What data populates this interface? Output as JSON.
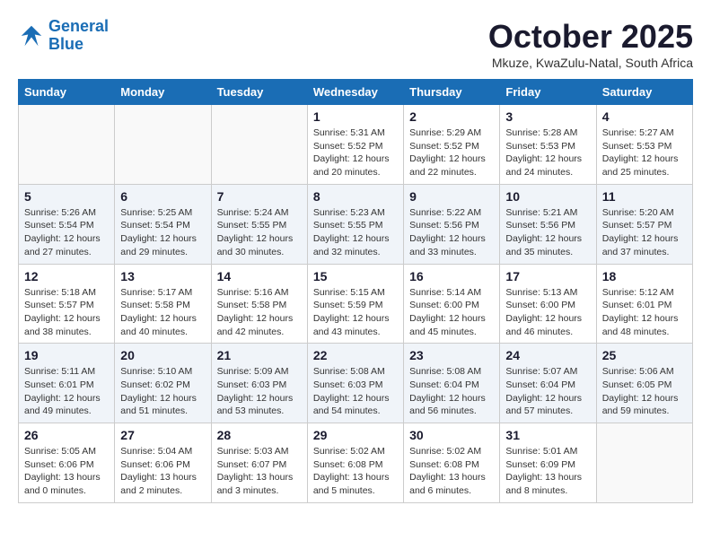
{
  "header": {
    "logo_line1": "General",
    "logo_line2": "Blue",
    "month_title": "October 2025",
    "location": "Mkuze, KwaZulu-Natal, South Africa"
  },
  "days_of_week": [
    "Sunday",
    "Monday",
    "Tuesday",
    "Wednesday",
    "Thursday",
    "Friday",
    "Saturday"
  ],
  "weeks": [
    [
      {
        "day": "",
        "info": ""
      },
      {
        "day": "",
        "info": ""
      },
      {
        "day": "",
        "info": ""
      },
      {
        "day": "1",
        "info": "Sunrise: 5:31 AM\nSunset: 5:52 PM\nDaylight: 12 hours\nand 20 minutes."
      },
      {
        "day": "2",
        "info": "Sunrise: 5:29 AM\nSunset: 5:52 PM\nDaylight: 12 hours\nand 22 minutes."
      },
      {
        "day": "3",
        "info": "Sunrise: 5:28 AM\nSunset: 5:53 PM\nDaylight: 12 hours\nand 24 minutes."
      },
      {
        "day": "4",
        "info": "Sunrise: 5:27 AM\nSunset: 5:53 PM\nDaylight: 12 hours\nand 25 minutes."
      }
    ],
    [
      {
        "day": "5",
        "info": "Sunrise: 5:26 AM\nSunset: 5:54 PM\nDaylight: 12 hours\nand 27 minutes."
      },
      {
        "day": "6",
        "info": "Sunrise: 5:25 AM\nSunset: 5:54 PM\nDaylight: 12 hours\nand 29 minutes."
      },
      {
        "day": "7",
        "info": "Sunrise: 5:24 AM\nSunset: 5:55 PM\nDaylight: 12 hours\nand 30 minutes."
      },
      {
        "day": "8",
        "info": "Sunrise: 5:23 AM\nSunset: 5:55 PM\nDaylight: 12 hours\nand 32 minutes."
      },
      {
        "day": "9",
        "info": "Sunrise: 5:22 AM\nSunset: 5:56 PM\nDaylight: 12 hours\nand 33 minutes."
      },
      {
        "day": "10",
        "info": "Sunrise: 5:21 AM\nSunset: 5:56 PM\nDaylight: 12 hours\nand 35 minutes."
      },
      {
        "day": "11",
        "info": "Sunrise: 5:20 AM\nSunset: 5:57 PM\nDaylight: 12 hours\nand 37 minutes."
      }
    ],
    [
      {
        "day": "12",
        "info": "Sunrise: 5:18 AM\nSunset: 5:57 PM\nDaylight: 12 hours\nand 38 minutes."
      },
      {
        "day": "13",
        "info": "Sunrise: 5:17 AM\nSunset: 5:58 PM\nDaylight: 12 hours\nand 40 minutes."
      },
      {
        "day": "14",
        "info": "Sunrise: 5:16 AM\nSunset: 5:58 PM\nDaylight: 12 hours\nand 42 minutes."
      },
      {
        "day": "15",
        "info": "Sunrise: 5:15 AM\nSunset: 5:59 PM\nDaylight: 12 hours\nand 43 minutes."
      },
      {
        "day": "16",
        "info": "Sunrise: 5:14 AM\nSunset: 6:00 PM\nDaylight: 12 hours\nand 45 minutes."
      },
      {
        "day": "17",
        "info": "Sunrise: 5:13 AM\nSunset: 6:00 PM\nDaylight: 12 hours\nand 46 minutes."
      },
      {
        "day": "18",
        "info": "Sunrise: 5:12 AM\nSunset: 6:01 PM\nDaylight: 12 hours\nand 48 minutes."
      }
    ],
    [
      {
        "day": "19",
        "info": "Sunrise: 5:11 AM\nSunset: 6:01 PM\nDaylight: 12 hours\nand 49 minutes."
      },
      {
        "day": "20",
        "info": "Sunrise: 5:10 AM\nSunset: 6:02 PM\nDaylight: 12 hours\nand 51 minutes."
      },
      {
        "day": "21",
        "info": "Sunrise: 5:09 AM\nSunset: 6:03 PM\nDaylight: 12 hours\nand 53 minutes."
      },
      {
        "day": "22",
        "info": "Sunrise: 5:08 AM\nSunset: 6:03 PM\nDaylight: 12 hours\nand 54 minutes."
      },
      {
        "day": "23",
        "info": "Sunrise: 5:08 AM\nSunset: 6:04 PM\nDaylight: 12 hours\nand 56 minutes."
      },
      {
        "day": "24",
        "info": "Sunrise: 5:07 AM\nSunset: 6:04 PM\nDaylight: 12 hours\nand 57 minutes."
      },
      {
        "day": "25",
        "info": "Sunrise: 5:06 AM\nSunset: 6:05 PM\nDaylight: 12 hours\nand 59 minutes."
      }
    ],
    [
      {
        "day": "26",
        "info": "Sunrise: 5:05 AM\nSunset: 6:06 PM\nDaylight: 13 hours\nand 0 minutes."
      },
      {
        "day": "27",
        "info": "Sunrise: 5:04 AM\nSunset: 6:06 PM\nDaylight: 13 hours\nand 2 minutes."
      },
      {
        "day": "28",
        "info": "Sunrise: 5:03 AM\nSunset: 6:07 PM\nDaylight: 13 hours\nand 3 minutes."
      },
      {
        "day": "29",
        "info": "Sunrise: 5:02 AM\nSunset: 6:08 PM\nDaylight: 13 hours\nand 5 minutes."
      },
      {
        "day": "30",
        "info": "Sunrise: 5:02 AM\nSunset: 6:08 PM\nDaylight: 13 hours\nand 6 minutes."
      },
      {
        "day": "31",
        "info": "Sunrise: 5:01 AM\nSunset: 6:09 PM\nDaylight: 13 hours\nand 8 minutes."
      },
      {
        "day": "",
        "info": ""
      }
    ]
  ]
}
